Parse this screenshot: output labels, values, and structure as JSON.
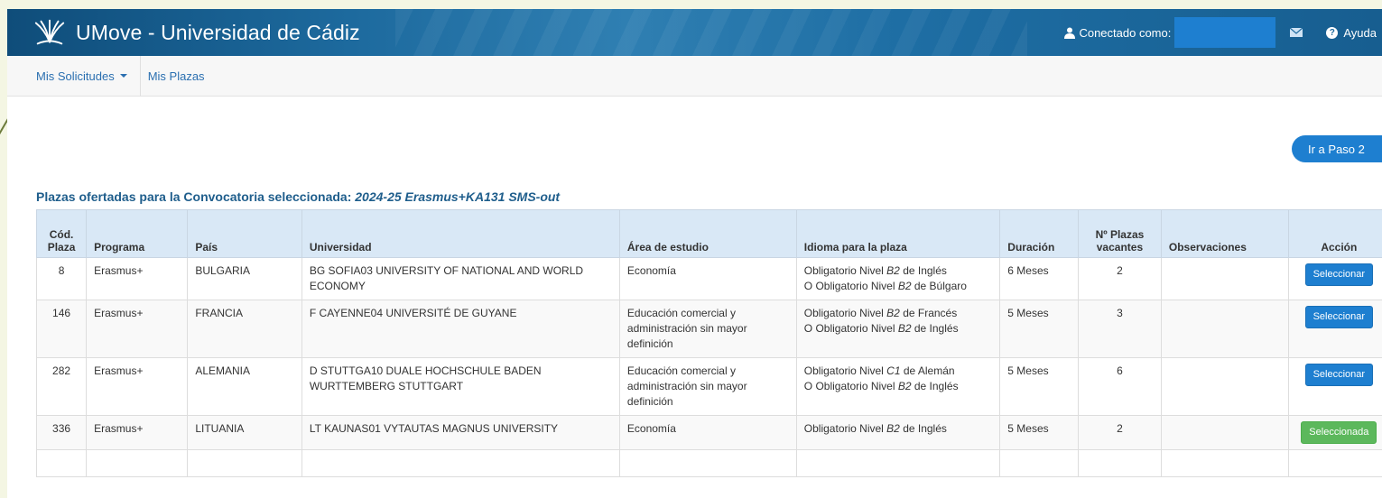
{
  "header": {
    "title": "UMove - Universidad de Cádiz",
    "connected_label": "Conectado como:",
    "help_label": "Ayuda"
  },
  "nav": {
    "items": [
      {
        "label": "Mis Solicitudes"
      },
      {
        "label": "Mis Plazas"
      }
    ]
  },
  "step_button": "Ir a Paso 2",
  "section": {
    "title_prefix": "Plazas ofertadas para la Convocatoria seleccionada:",
    "convocatoria": "2024-25 Erasmus+KA131 SMS-out"
  },
  "table": {
    "headers": {
      "cod": "Cód. Plaza",
      "programa": "Programa",
      "pais": "País",
      "universidad": "Universidad",
      "area": "Área de estudio",
      "idioma": "Idioma para la plaza",
      "duracion": "Duración",
      "plazas": "Nº Plazas vacantes",
      "observaciones": "Observaciones",
      "accion": "Acción"
    },
    "rows": [
      {
        "cod": "8",
        "programa": "Erasmus+",
        "pais": "BULGARIA",
        "universidad": "BG SOFIA03 UNIVERSITY OF NATIONAL AND WORLD ECONOMY",
        "area": "Economía",
        "idioma_1a": "Obligatorio Nivel ",
        "idioma_1lvl": "B2",
        "idioma_1b": " de Inglés",
        "idioma_2a": "O Obligatorio Nivel ",
        "idioma_2lvl": "B2",
        "idioma_2b": " de Búlgaro",
        "duracion": "6 Meses",
        "plazas": "2",
        "observaciones": "",
        "accion": "Seleccionar"
      },
      {
        "cod": "146",
        "programa": "Erasmus+",
        "pais": "FRANCIA",
        "universidad": "F CAYENNE04 UNIVERSITÉ DE GUYANE",
        "area": "Educación comercial y administración sin mayor definición",
        "idioma_1a": "Obligatorio Nivel ",
        "idioma_1lvl": "B2",
        "idioma_1b": " de Francés",
        "idioma_2a": "O Obligatorio Nivel ",
        "idioma_2lvl": "B2",
        "idioma_2b": " de Inglés",
        "duracion": "5 Meses",
        "plazas": "3",
        "observaciones": "",
        "accion": "Seleccionar"
      },
      {
        "cod": "282",
        "programa": "Erasmus+",
        "pais": "ALEMANIA",
        "universidad": "D STUTTGA10 DUALE HOCHSCHULE BADEN WURTTEMBERG STUTTGART",
        "area": "Educación comercial y administración sin mayor definición",
        "idioma_1a": "Obligatorio Nivel ",
        "idioma_1lvl": "C1",
        "idioma_1b": " de Alemán",
        "idioma_2a": "O Obligatorio Nivel ",
        "idioma_2lvl": "B2",
        "idioma_2b": " de Inglés",
        "duracion": "5 Meses",
        "plazas": "6",
        "observaciones": "",
        "accion": "Seleccionar"
      },
      {
        "cod": "336",
        "programa": "Erasmus+",
        "pais": "LITUANIA",
        "universidad": "LT KAUNAS01 VYTAUTAS MAGNUS UNIVERSITY",
        "area": "Economía",
        "idioma_1a": "Obligatorio Nivel ",
        "idioma_1lvl": "B2",
        "idioma_1b": " de Inglés",
        "duracion": "5 Meses",
        "plazas": "2",
        "observaciones": "",
        "accion": "Seleccionada"
      }
    ]
  },
  "colors": {
    "header_blue": "#1d6a9e",
    "link_blue": "#2a6fb0",
    "button_blue": "#1e7fd0",
    "selected_green": "#5cb85c",
    "table_header_bg": "#d9e8f6"
  }
}
